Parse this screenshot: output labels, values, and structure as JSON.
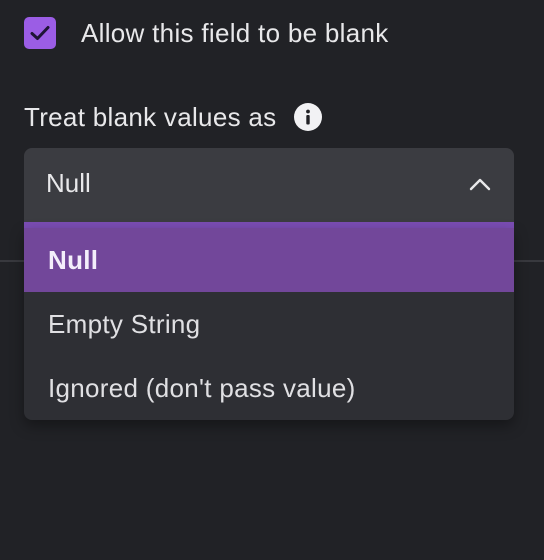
{
  "checkbox": {
    "checked": true,
    "label": "Allow this field to be blank"
  },
  "blank_values": {
    "label": "Treat blank values as",
    "info_icon": "info-icon"
  },
  "select": {
    "value": "Null",
    "chevron_icon": "chevron-up-icon",
    "options": [
      {
        "label": "Null",
        "selected": true
      },
      {
        "label": "Empty String",
        "selected": false
      },
      {
        "label": "Ignored (don't pass value)",
        "selected": false
      }
    ]
  },
  "colors": {
    "background": "#212226",
    "checkbox": "#9b5de5",
    "selected_option": "#72479a",
    "select_box": "#3b3c41",
    "dropdown": "#2e2f34"
  }
}
